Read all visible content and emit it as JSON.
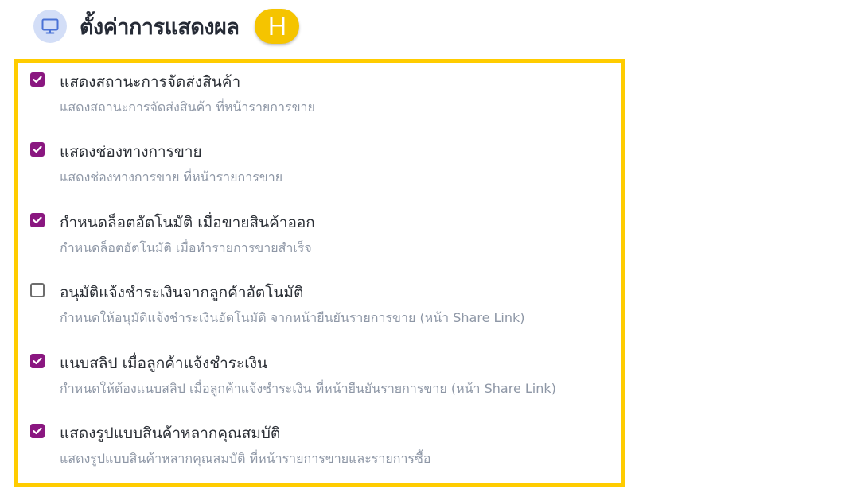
{
  "header": {
    "title": "ตั้งค่าการแสดงผล",
    "icon": "monitor-icon",
    "marker": "H",
    "marker_color": "#f5c400"
  },
  "accent_color": "#8a1780",
  "box_border_color": "#ffcc00",
  "settings": [
    {
      "label": "แสดงสถานะการจัดส่งสินค้า",
      "description": "แสดงสถานะการจัดส่งสินค้า ที่หน้ารายการขาย",
      "checked": true
    },
    {
      "label": "แสดงช่องทางการขาย",
      "description": "แสดงช่องทางการขาย ที่หน้ารายการขาย",
      "checked": true
    },
    {
      "label": "กำหนดล็อตอัตโนมัติ เมื่อขายสินค้าออก",
      "description": "กำหนดล็อตอัตโนมัติ เมื่อทำรายการขายสำเร็จ",
      "checked": true
    },
    {
      "label": "อนุมัติแจ้งชำระเงินจากลูกค้าอัตโนมัติ",
      "description": "กำหนดให้อนุมัติแจ้งชำระเงินอัตโนมัติ จากหน้ายืนยันรายการขาย (หน้า Share Link)",
      "checked": false
    },
    {
      "label": "แนบสลิป เมื่อลูกค้าแจ้งชำระเงิน",
      "description": "กำหนดให้ต้องแนบสลิป เมื่อลูกค้าแจ้งชำระเงิน ที่หน้ายืนยันรายการขาย (หน้า Share Link)",
      "checked": true
    },
    {
      "label": "แสดงรูปแบบสินค้าหลากคุณสมบัติ",
      "description": "แสดงรูปแบบสินค้าหลากคุณสมบัติ ที่หน้ารายการขายและรายการซื้อ",
      "checked": true
    }
  ]
}
